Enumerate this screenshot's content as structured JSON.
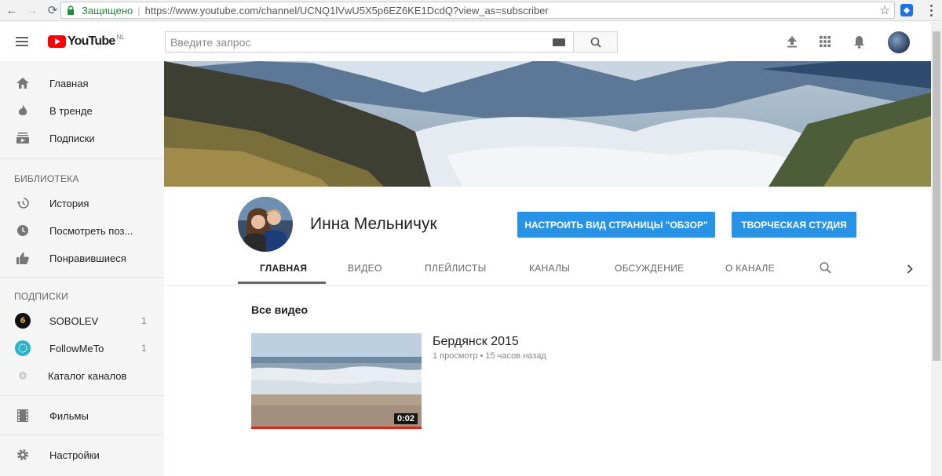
{
  "browser": {
    "secure_label": "Защищено",
    "url": "https://www.youtube.com/channel/UCNQ1lVwU5X5p6EZ6KE1DcdQ?view_as=subscriber"
  },
  "masthead": {
    "logo_text": "YouTube",
    "region": "NL",
    "search_placeholder": "Введите запрос"
  },
  "sidebar": {
    "main": [
      {
        "label": "Главная",
        "icon": "home-icon"
      },
      {
        "label": "В тренде",
        "icon": "trending-icon"
      },
      {
        "label": "Подписки",
        "icon": "subscriptions-icon"
      }
    ],
    "library_heading": "БИБЛИОТЕКА",
    "library": [
      {
        "label": "История",
        "icon": "history-icon"
      },
      {
        "label": "Посмотреть поз...",
        "icon": "watch-later-icon"
      },
      {
        "label": "Понравившиеся",
        "icon": "thumbs-up-icon"
      }
    ],
    "subscriptions_heading": "ПОДПИСКИ",
    "subscriptions": [
      {
        "label": "SOBOLEV",
        "count": "1"
      },
      {
        "label": "FollowMeTo",
        "count": "1"
      },
      {
        "label": "Каталог каналов"
      }
    ],
    "movies": "Фильмы",
    "settings": "Настройки"
  },
  "channel": {
    "name": "Инна Мельничук",
    "customize_button": "НАСТРОИТЬ ВИД СТРАНИЦЫ \"ОБЗОР\"",
    "studio_button": "ТВОРЧЕСКАЯ СТУДИЯ",
    "tabs": [
      "ГЛАВНАЯ",
      "ВИДЕО",
      "ПЛЕЙЛИСТЫ",
      "КАНАЛЫ",
      "ОБСУЖДЕНИЕ",
      "О КАНАЛЕ"
    ],
    "active_tab": "ГЛАВНАЯ"
  },
  "content": {
    "section_title": "Все видео",
    "video": {
      "title": "Бердянск 2015",
      "meta": "1 просмотр • 15 часов назад",
      "duration": "0:02"
    }
  }
}
